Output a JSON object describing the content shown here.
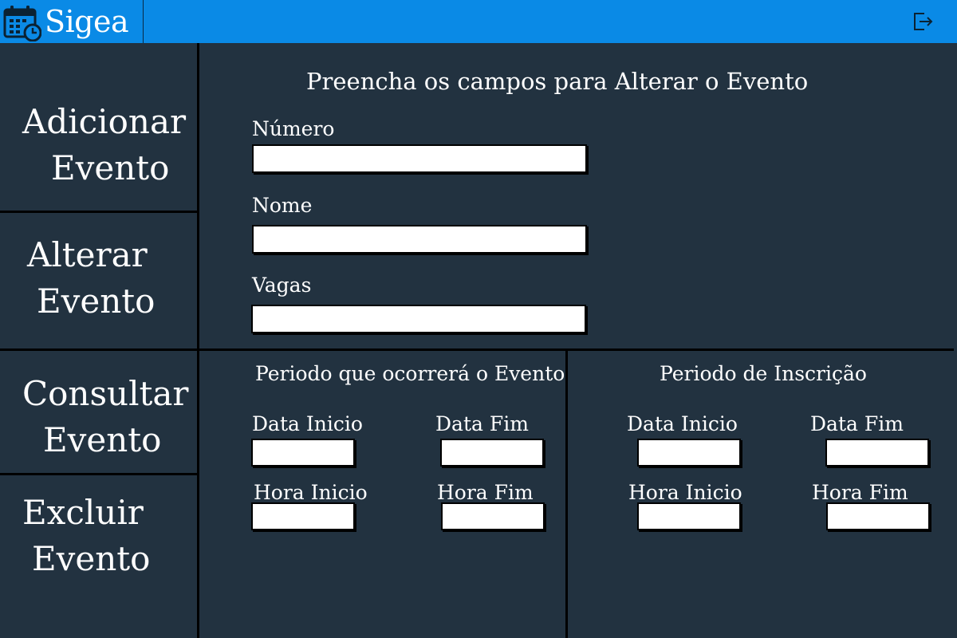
{
  "app": {
    "title": "Sigea",
    "logo_icon": "calendar-clock-icon",
    "logout_icon": "logout-icon",
    "topbar_color": "#0a8ae6",
    "background_color": "#223240"
  },
  "sidebar": {
    "items": [
      {
        "line1": "Adicionar",
        "line2": "Evento"
      },
      {
        "line1": "Alterar",
        "line2": "Evento"
      },
      {
        "line1": "Consultar",
        "line2": "Evento"
      },
      {
        "line1": "Excluir",
        "line2": "Evento"
      }
    ]
  },
  "form": {
    "title": "Preencha os campos para Alterar o Evento",
    "numero": {
      "label": "Número",
      "value": ""
    },
    "nome": {
      "label": "Nome",
      "value": ""
    },
    "vagas": {
      "label": "Vagas",
      "value": ""
    }
  },
  "periodo_evento": {
    "title": "Periodo que ocorrerá o Evento",
    "data_inicio": {
      "label": "Data Inicio",
      "value": ""
    },
    "data_fim": {
      "label": "Data Fim",
      "value": ""
    },
    "hora_inicio": {
      "label": "Hora Inicio",
      "value": ""
    },
    "hora_fim": {
      "label": "Hora Fim",
      "value": ""
    }
  },
  "periodo_inscricao": {
    "title": "Periodo de Inscrição",
    "data_inicio": {
      "label": "Data Inicio",
      "value": ""
    },
    "data_fim": {
      "label": "Data Fim",
      "value": ""
    },
    "hora_inicio": {
      "label": "Hora Inicio",
      "value": ""
    },
    "hora_fim": {
      "label": "Hora Fim",
      "value": ""
    }
  }
}
